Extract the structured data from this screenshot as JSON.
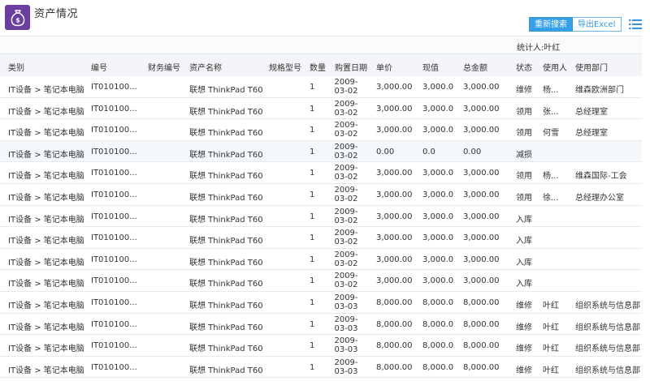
{
  "page": {
    "title": "资产情况"
  },
  "toolbar": {
    "search_label": "重新搜索",
    "export_label": "导出Excel"
  },
  "stats": {
    "label": "统计人:叶红"
  },
  "table": {
    "columns": [
      "类别",
      "编号",
      "财务编号",
      "资产名称",
      "规格型号",
      "数量",
      "购置日期",
      "单价",
      "现值",
      "总金额",
      "状态",
      "使用人",
      "使用部门"
    ],
    "rows": [
      {
        "category": "IT设备 > 笔记本电脑",
        "code": "IT010100...",
        "fin_code": "",
        "name": "联想 ThinkPad T60",
        "model": "",
        "qty": "1",
        "date_y": "2009-",
        "date_md": "03-02",
        "price": "3,000.00",
        "current": "3,000.0",
        "total": "3,000.00",
        "status": "维修",
        "user": "杨...",
        "dept": "维森欧洲部门"
      },
      {
        "category": "IT设备 > 笔记本电脑",
        "code": "IT010100...",
        "fin_code": "",
        "name": "联想 ThinkPad T60",
        "model": "",
        "qty": "1",
        "date_y": "2009-",
        "date_md": "03-02",
        "price": "3,000.00",
        "current": "3,000.0",
        "total": "3,000.00",
        "status": "领用",
        "user": "张...",
        "dept": "总经理室"
      },
      {
        "category": "IT设备 > 笔记本电脑",
        "code": "IT010100...",
        "fin_code": "",
        "name": "联想 ThinkPad T60",
        "model": "",
        "qty": "1",
        "date_y": "2009-",
        "date_md": "03-02",
        "price": "3,000.00",
        "current": "3,000.0",
        "total": "3,000.00",
        "status": "领用",
        "user": "何雪",
        "dept": "总经理室"
      },
      {
        "category": "IT设备 > 笔记本电脑",
        "code": "IT010100...",
        "fin_code": "",
        "name": "联想 ThinkPad T60",
        "model": "",
        "qty": "1",
        "date_y": "2009-",
        "date_md": "03-02",
        "price": "0.00",
        "current": "0.0",
        "total": "0.00",
        "status": "减损",
        "user": "",
        "dept": ""
      },
      {
        "category": "IT设备 > 笔记本电脑",
        "code": "IT010100...",
        "fin_code": "",
        "name": "联想 ThinkPad T60",
        "model": "",
        "qty": "1",
        "date_y": "2009-",
        "date_md": "03-02",
        "price": "3,000.00",
        "current": "3,000.0",
        "total": "3,000.00",
        "status": "领用",
        "user": "杨...",
        "dept": "维森国际-工会"
      },
      {
        "category": "IT设备 > 笔记本电脑",
        "code": "IT010100...",
        "fin_code": "",
        "name": "联想 ThinkPad T60",
        "model": "",
        "qty": "1",
        "date_y": "2009-",
        "date_md": "03-02",
        "price": "3,000.00",
        "current": "3,000.0",
        "total": "3,000.00",
        "status": "领用",
        "user": "徐...",
        "dept": "总经理办公室"
      },
      {
        "category": "IT设备 > 笔记本电脑",
        "code": "IT010100...",
        "fin_code": "",
        "name": "联想 ThinkPad T60",
        "model": "",
        "qty": "1",
        "date_y": "2009-",
        "date_md": "03-02",
        "price": "3,000.00",
        "current": "3,000.0",
        "total": "3,000.00",
        "status": "入库",
        "user": "",
        "dept": ""
      },
      {
        "category": "IT设备 > 笔记本电脑",
        "code": "IT010100...",
        "fin_code": "",
        "name": "联想 ThinkPad T60",
        "model": "",
        "qty": "1",
        "date_y": "2009-",
        "date_md": "03-02",
        "price": "3,000.00",
        "current": "3,000.0",
        "total": "3,000.00",
        "status": "入库",
        "user": "",
        "dept": ""
      },
      {
        "category": "IT设备 > 笔记本电脑",
        "code": "IT010100...",
        "fin_code": "",
        "name": "联想 ThinkPad T60",
        "model": "",
        "qty": "1",
        "date_y": "2009-",
        "date_md": "03-02",
        "price": "3,000.00",
        "current": "3,000.0",
        "total": "3,000.00",
        "status": "入库",
        "user": "",
        "dept": ""
      },
      {
        "category": "IT设备 > 笔记本电脑",
        "code": "IT010100...",
        "fin_code": "",
        "name": "联想 ThinkPad T60",
        "model": "",
        "qty": "1",
        "date_y": "2009-",
        "date_md": "03-02",
        "price": "3,000.00",
        "current": "3,000.0",
        "total": "3,000.00",
        "status": "入库",
        "user": "",
        "dept": ""
      },
      {
        "category": "IT设备 > 笔记本电脑",
        "code": "IT010100...",
        "fin_code": "",
        "name": "联想 ThinkPad T60",
        "model": "",
        "qty": "1",
        "date_y": "2009-",
        "date_md": "03-03",
        "price": "8,000.00",
        "current": "8,000.0",
        "total": "8,000.00",
        "status": "维修",
        "user": "叶红",
        "dept": "组织系统与信息部"
      },
      {
        "category": "IT设备 > 笔记本电脑",
        "code": "IT010100...",
        "fin_code": "",
        "name": "联想 ThinkPad T60",
        "model": "",
        "qty": "1",
        "date_y": "2009-",
        "date_md": "03-03",
        "price": "8,000.00",
        "current": "8,000.0",
        "total": "8,000.00",
        "status": "维修",
        "user": "叶红",
        "dept": "组织系统与信息部"
      },
      {
        "category": "IT设备 > 笔记本电脑",
        "code": "IT010100...",
        "fin_code": "",
        "name": "联想 ThinkPad T60",
        "model": "",
        "qty": "1",
        "date_y": "2009-",
        "date_md": "03-03",
        "price": "8,000.00",
        "current": "8,000.0",
        "total": "8,000.00",
        "status": "维修",
        "user": "叶红",
        "dept": "组织系统与信息部"
      },
      {
        "category": "IT设备 > 笔记本电脑",
        "code": "IT010100...",
        "fin_code": "",
        "name": "联想 ThinkPad T60",
        "model": "",
        "qty": "1",
        "date_y": "2009-",
        "date_md": "03-03",
        "price": "8,000.00",
        "current": "8,000.0",
        "total": "8,000.00",
        "status": "维修",
        "user": "叶红",
        "dept": "组织系统与信息部"
      }
    ]
  },
  "colors": {
    "accent": "#36a0e6",
    "app_icon_bg": "#6b3fa0",
    "header_border": "#bcd7ee"
  },
  "icons": {
    "app": "money-bag-icon",
    "menu": "list-icon"
  }
}
